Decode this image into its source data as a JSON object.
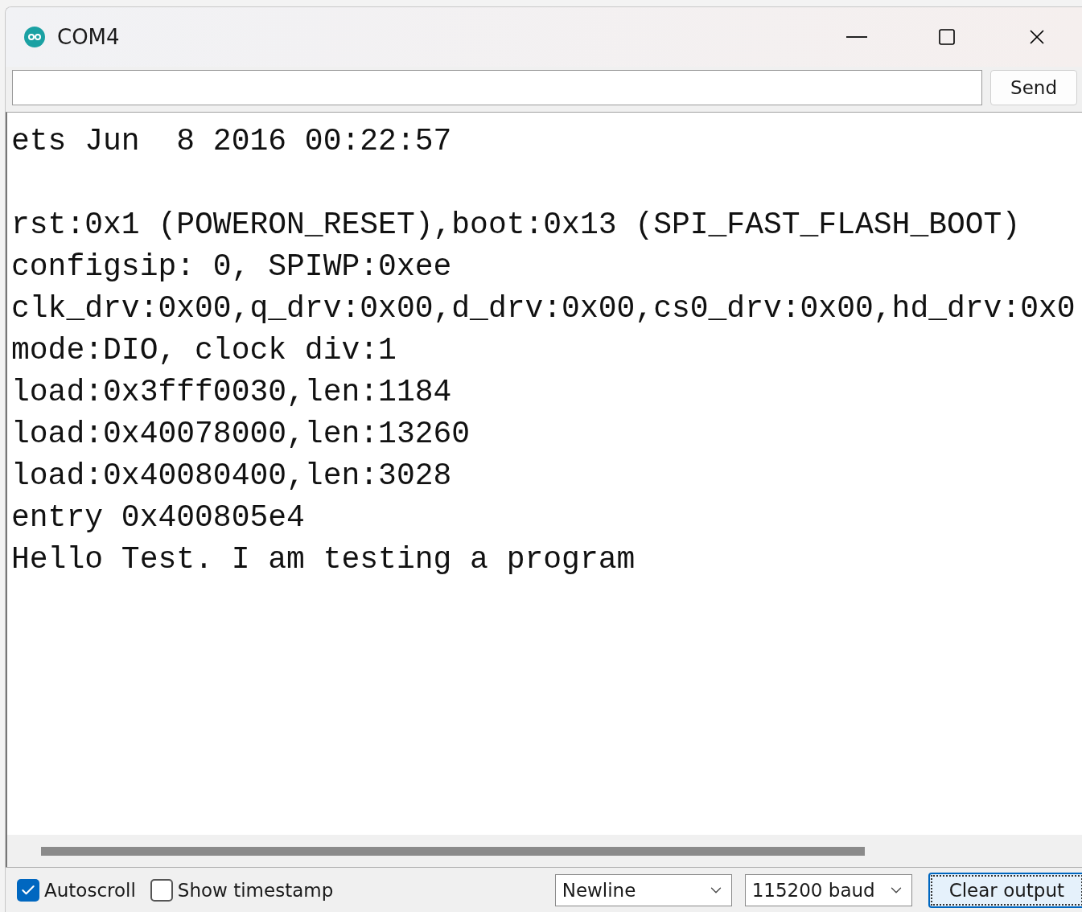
{
  "window": {
    "title": "COM4"
  },
  "input": {
    "send_button": "Send"
  },
  "output": {
    "blocks": [
      {
        "lines": [
          "ets Jun  8 2016 00:22:57"
        ]
      },
      {
        "lines": [
          "rst:0x1 (POWERON_RESET),boot:0x13 (SPI_FAST_FLASH_BOOT)",
          "configsip: 0, SPIWP:0xee",
          "clk_drv:0x00,q_drv:0x00,d_drv:0x00,cs0_drv:0x00,hd_drv:0x0",
          "mode:DIO, clock div:1",
          "load:0x3fff0030,len:1184",
          "load:0x40078000,len:13260",
          "load:0x40080400,len:3028",
          "entry 0x400805e4",
          "Hello Test. I am testing a program"
        ]
      }
    ]
  },
  "footer": {
    "checkboxes": [
      {
        "label": "Autoscroll",
        "checked": true
      },
      {
        "label": "Show timestamp",
        "checked": false
      }
    ],
    "dropdowns": [
      {
        "value": "Newline"
      },
      {
        "value": "115200 baud"
      }
    ],
    "clear_button": "Clear output"
  }
}
